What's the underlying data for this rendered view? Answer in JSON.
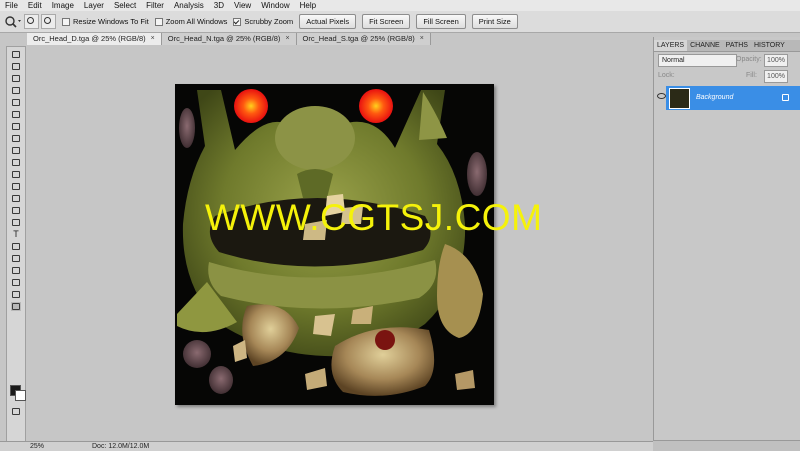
{
  "menu": [
    "File",
    "Edit",
    "Image",
    "Layer",
    "Select",
    "Filter",
    "Analysis",
    "3D",
    "View",
    "Window",
    "Help"
  ],
  "options": {
    "resize_windows": "Resize Windows To Fit",
    "zoom_all": "Zoom All Windows",
    "scrubby_zoom": "Scrubby Zoom",
    "actual_pixels": "Actual Pixels",
    "fit_screen": "Fit Screen",
    "fill_screen": "Fill Screen",
    "print_size": "Print Size"
  },
  "doc_tabs": [
    "Orc_Head_D.tga @ 25% (RGB/8)",
    "Orc_Head_N.tga @ 25% (RGB/8)",
    "Orc_Head_S.tga @ 25% (RGB/8)"
  ],
  "tab_close": "×",
  "panel": {
    "tabs": [
      "LAYERS",
      "CHANNE",
      "PATHS",
      "HISTORY"
    ],
    "blend_mode": "Normal",
    "opacity_label": "Opacity:",
    "opacity": "100%",
    "lock_label": "Lock:",
    "fill_label": "Fill:",
    "fill": "100%",
    "layer_name": "Background"
  },
  "status": {
    "zoom": "25%",
    "doc": "Doc: 12.0M/12.0M"
  },
  "watermark": "WWW.CGTSJ.COM",
  "colors": {
    "accent_blue": "#3a8ee6",
    "watermark_yellow": "#f5f20a"
  }
}
